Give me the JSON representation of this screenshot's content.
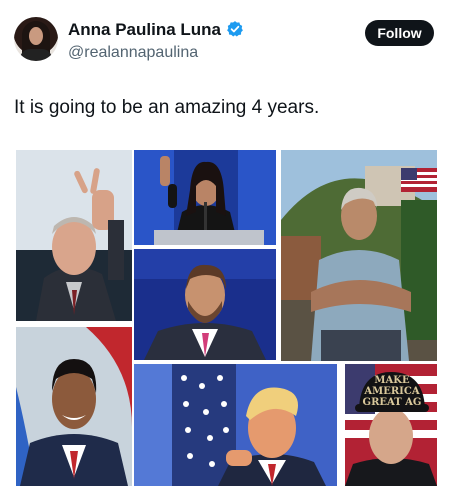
{
  "author": {
    "name": "Anna Paulina Luna",
    "handle": "@realannapaulina",
    "verified": true,
    "avatar_icon": "avatar-photo"
  },
  "actions": {
    "follow_label": "Follow"
  },
  "tweet": {
    "text": "It is going to be an amazing 4 years."
  },
  "media": {
    "photo_count": 7,
    "hat_text": "MAKE AMERICA GREAT AG"
  },
  "colors": {
    "verified_blue": "#1d9bf0",
    "follow_bg": "#0f1419",
    "handle_gray": "#536471"
  }
}
